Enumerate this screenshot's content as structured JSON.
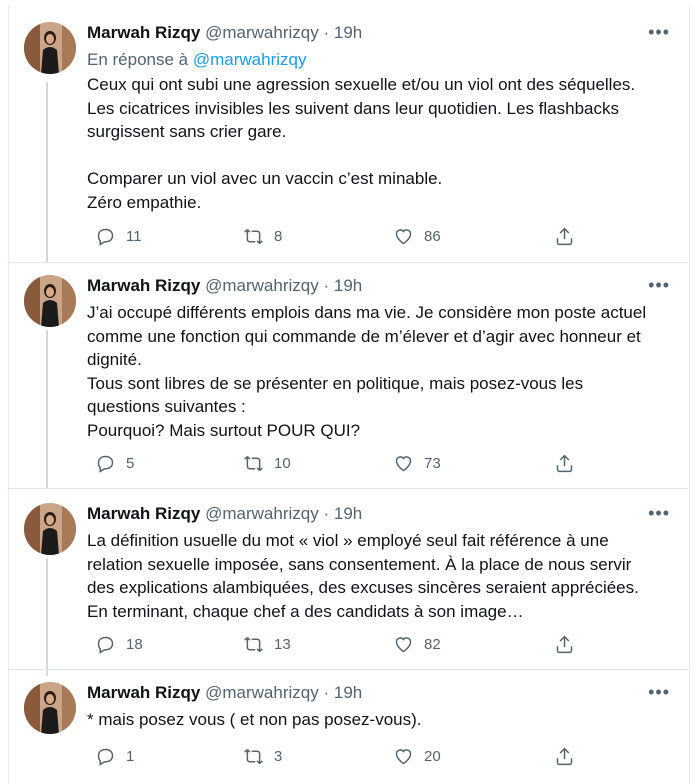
{
  "tweets": [
    {
      "name": "Marwah Rizqy",
      "handle": "@marwahrizqy",
      "separator": "·",
      "time": "19h",
      "reply_prefix": "En réponse à",
      "reply_handle": "@marwahrizqy",
      "lines": [
        "Ceux qui ont subi une agression sexuelle et/ou un viol ont des séquelles.",
        "Les cicatrices invisibles les suivent dans leur quotidien. Les flashbacks",
        "surgissent sans crier gare.",
        "",
        "Comparer un viol avec un vaccin c’est minable.",
        "Zéro empathie."
      ],
      "replies": "11",
      "retweets": "8",
      "likes": "86"
    },
    {
      "name": "Marwah Rizqy",
      "handle": "@marwahrizqy",
      "separator": "·",
      "time": "19h",
      "lines": [
        "J’ai occupé différents emplois dans ma vie. Je considère mon poste actuel",
        "comme une fonction qui commande de m’élever et d’agir avec honneur et",
        "dignité.",
        "Tous sont libres de se présenter en politique, mais posez-vous les",
        "questions suivantes :",
        "Pourquoi? Mais surtout POUR QUI?"
      ],
      "replies": "5",
      "retweets": "10",
      "likes": "73"
    },
    {
      "name": "Marwah Rizqy",
      "handle": "@marwahrizqy",
      "separator": "·",
      "time": "19h",
      "lines": [
        "La définition usuelle du mot « viol » employé seul fait référence à une",
        "relation sexuelle imposée, sans consentement. À la place de nous servir",
        "des explications alambiquées, des excuses sincères seraient appréciées.",
        "En terminant, chaque chef a des candidats à son image…"
      ],
      "replies": "18",
      "retweets": "13",
      "likes": "82"
    },
    {
      "name": "Marwah Rizqy",
      "handle": "@marwahrizqy",
      "separator": "·",
      "time": "19h",
      "lines": [
        "* mais posez vous ( et non pas posez-vous)."
      ],
      "replies": "1",
      "retweets": "3",
      "likes": "20"
    }
  ],
  "icons": {
    "reply": "reply-icon",
    "retweet": "retweet-icon",
    "like": "heart-icon",
    "share": "share-icon",
    "more": "more-icon"
  },
  "colors": {
    "link": "#1d9bf0",
    "secondary_text": "#536471",
    "thread_line": "#cfd9de"
  }
}
